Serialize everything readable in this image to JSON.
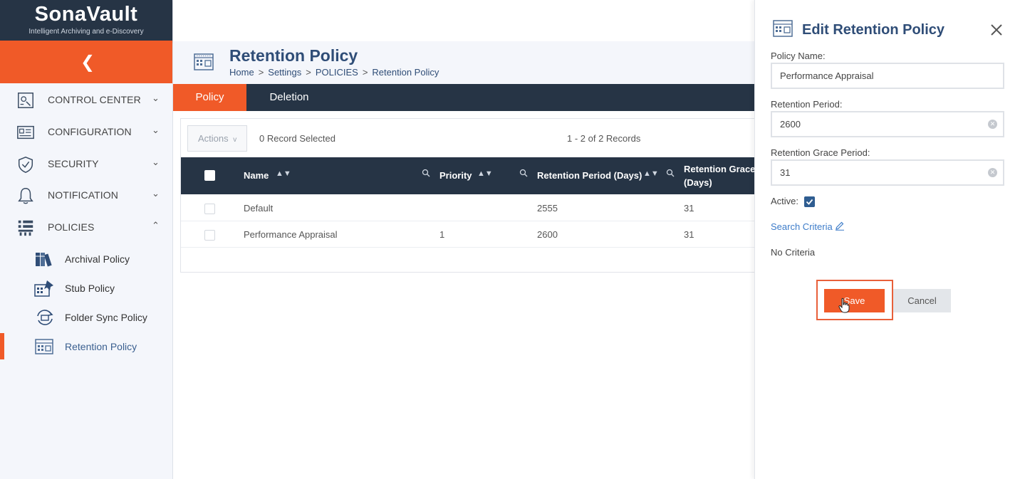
{
  "app": {
    "logo_text": "SonaVault",
    "logo_tagline": "Intelligent Archiving and e-Discovery",
    "accent_color": "#f05a28",
    "dark_color": "#263445",
    "link_color": "#3d7cc9"
  },
  "sidebar": {
    "collapse_icon": "chevron-left-icon",
    "items": [
      {
        "label": "CONTROL CENTER",
        "icon": "control-center-icon",
        "caret": "chevron-down-icon"
      },
      {
        "label": "CONFIGURATION",
        "icon": "configuration-icon",
        "caret": "chevron-down-icon"
      },
      {
        "label": "SECURITY",
        "icon": "shield-icon",
        "caret": "chevron-down-icon"
      },
      {
        "label": "NOTIFICATION",
        "icon": "bell-icon",
        "caret": "chevron-down-icon"
      },
      {
        "label": "POLICIES",
        "icon": "policies-icon",
        "caret": "chevron-up-icon"
      }
    ],
    "sub_items": [
      {
        "label": "Archival Policy",
        "icon": "archival-policy-icon"
      },
      {
        "label": "Stub Policy",
        "icon": "stub-policy-icon"
      },
      {
        "label": "Folder Sync Policy",
        "icon": "folder-sync-icon"
      },
      {
        "label": "Retention Policy",
        "icon": "retention-policy-icon",
        "active": true
      }
    ]
  },
  "page": {
    "title": "Retention Policy",
    "breadcrumb": [
      "Home",
      "Settings",
      "POLICIES",
      "Retention Policy"
    ],
    "breadcrumb_sep": ">"
  },
  "tabs": [
    {
      "label": "Policy",
      "active": true
    },
    {
      "label": "Deletion",
      "active": false
    }
  ],
  "grid": {
    "actions_label": "Actions",
    "actions_caret": "v",
    "selected_text": "0 Record Selected",
    "count_text": "1 - 2 of 2 Records",
    "columns": [
      {
        "label": "Name"
      },
      {
        "label": "Priority"
      },
      {
        "label": "Retention Period (Days)"
      },
      {
        "label_line1": "Retention Grace",
        "label_line2": "(Days)"
      }
    ],
    "rows": [
      {
        "name": "Default",
        "priority": "",
        "retention_period": "2555",
        "grace": "31"
      },
      {
        "name": "Performance Appraisal",
        "priority": "1",
        "retention_period": "2600",
        "grace": "31"
      }
    ]
  },
  "panel": {
    "title": "Edit Retention Policy",
    "policy_name_label": "Policy Name:",
    "policy_name_value": "Performance Appraisal",
    "retention_period_label": "Retention Period:",
    "retention_period_value": "2600",
    "grace_period_label": "Retention Grace Period:",
    "grace_period_value": "31",
    "active_label": "Active:",
    "active_checked": true,
    "search_criteria_label": "Search Criteria",
    "no_criteria_text": "No Criteria",
    "save_label": "Save",
    "cancel_label": "Cancel"
  }
}
